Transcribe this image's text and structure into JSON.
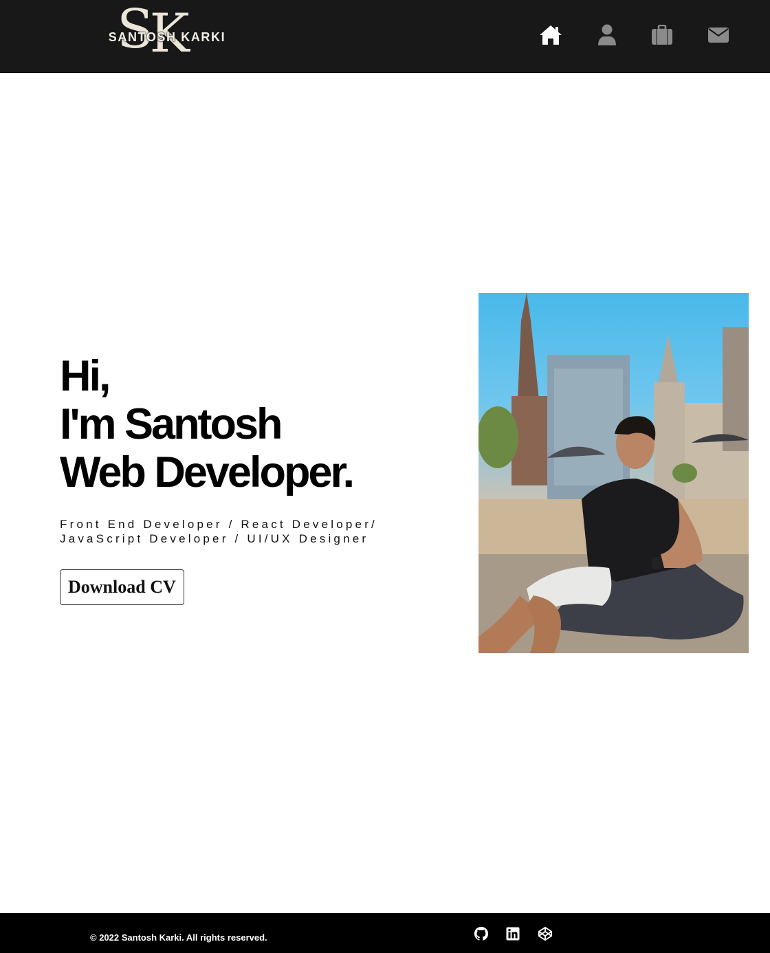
{
  "header": {
    "logo_monogram_s": "S",
    "logo_monogram_k": "K",
    "logo_name": "SANTOSH KARKI",
    "nav": [
      {
        "icon": "home-icon",
        "color": "#ffffff"
      },
      {
        "icon": "user-icon",
        "color": "#8a8a8a"
      },
      {
        "icon": "briefcase-icon",
        "color": "#8a8a8a"
      },
      {
        "icon": "envelope-icon",
        "color": "#8a8a8a"
      }
    ]
  },
  "hero": {
    "line1": "Hi,",
    "line2": "I'm Santosh",
    "line3": "Web Developer.",
    "roles_line1": "Front End Developer / React Developer/",
    "roles_line2": "JavaScript Developer / UI/UX Designer",
    "cv_button": "Download CV"
  },
  "photo": {
    "subject": "portrait-photo"
  },
  "footer": {
    "copyright": "© 2022 Santosh Karki. All rights reserved.",
    "social": [
      {
        "icon": "github-icon"
      },
      {
        "icon": "linkedin-icon"
      },
      {
        "icon": "codepen-icon"
      }
    ]
  },
  "colors": {
    "header_bg": "#181818",
    "footer_bg": "#000000",
    "active_nav": "#ffffff",
    "inactive_nav": "#8a8a8a"
  }
}
